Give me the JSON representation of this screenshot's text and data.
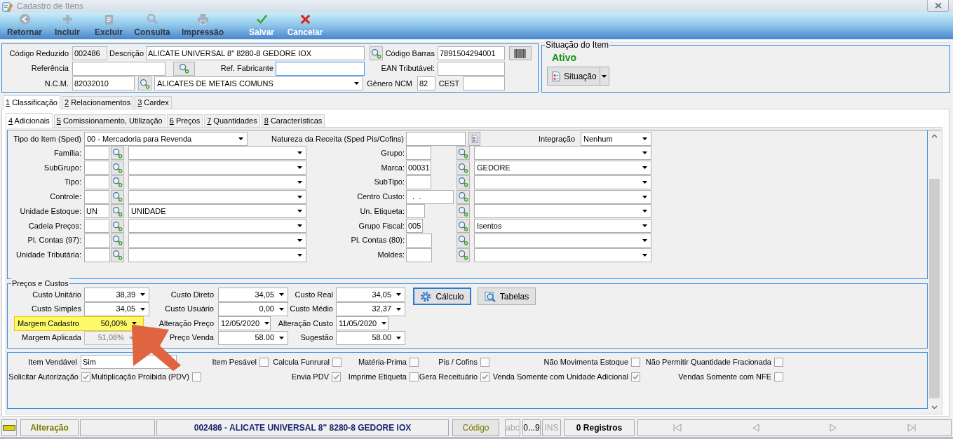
{
  "window": {
    "title": "Cadastro de Itens"
  },
  "toolbar": [
    {
      "label": "Retornar",
      "disabled": true
    },
    {
      "label": "Incluir",
      "disabled": true
    },
    {
      "label": "Excluir",
      "disabled": true
    },
    {
      "label": "Consulta",
      "disabled": true
    },
    {
      "label": "Impressão",
      "disabled": true
    },
    {
      "label": "Salvar",
      "disabled": false
    },
    {
      "label": "Cancelar",
      "disabled": false
    }
  ],
  "item_header": {
    "codigo_reduzido": {
      "label": "Código Reduzido",
      "value": "002486",
      "readonly": true
    },
    "descricao": {
      "label": "Descrição",
      "value": "ALICATE UNIVERSAL 8\" 8280-8 GEDORE IOX"
    },
    "codigo_barras": {
      "label": "Código Barras",
      "value": "7891504294001"
    },
    "referencia": {
      "label": "Referência"
    },
    "ref_fabricante": {
      "label": "Ref. Fabricante",
      "focused": true
    },
    "ean_tributavel": {
      "label": "EAN Tributável:"
    },
    "ncm": {
      "label": "N.C.M.",
      "value": "82032010",
      "description": "ALICATES DE METAIS COMUNS"
    },
    "genero_ncm": {
      "label": "Gênero NCM",
      "value": "82"
    },
    "cest": {
      "label": "CEST"
    }
  },
  "situacao": {
    "title": "Situação do Item",
    "status": "Ativo",
    "button": "Situação"
  },
  "tabs": [
    {
      "label": "1 Classificação",
      "selected": true
    },
    {
      "label": "2 Relacionamentos",
      "selected": false
    },
    {
      "label": "3 Cardex",
      "selected": false
    }
  ],
  "subtabs": [
    {
      "label": "4 Adicionais",
      "selected": true
    },
    {
      "label": "5 Comissionamento, Utilização",
      "selected": false
    },
    {
      "label": "6 Preços",
      "selected": false
    },
    {
      "label": "7 Quantidades",
      "selected": false
    },
    {
      "label": "8 Características",
      "selected": false
    }
  ],
  "classificacao": {
    "tipo_item": {
      "label": "Tipo do Item (Sped)",
      "value": "00 - Mercadoria para Revenda"
    },
    "natureza_receita": {
      "label": "Natureza da Receita (Sped Pis/Cofins)"
    },
    "integracao": {
      "label": "Integração",
      "value": "Nenhum"
    },
    "left_fields": [
      {
        "label": "Família:"
      },
      {
        "label": "SubGrupo:"
      },
      {
        "label": "Tipo:"
      },
      {
        "label": "Controle:"
      },
      {
        "label": "Unidade Estoque:",
        "code": "UN",
        "description": "UNIDADE"
      },
      {
        "label": "Cadeia Preços:"
      },
      {
        "label": "Pl. Contas (97):"
      },
      {
        "label": "Unidade Tributária:"
      }
    ],
    "right_fields": [
      {
        "label": "Grupo:"
      },
      {
        "label": "Marca:",
        "code": "00031",
        "description": "GEDORE"
      },
      {
        "label": "SubTipo:"
      },
      {
        "label": "Centro Custo:",
        "code": "  .  ."
      },
      {
        "label": "Un. Etiqueta:"
      },
      {
        "label": "Grupo Fiscal:",
        "code": "005",
        "description": "Isentos"
      },
      {
        "label": "Pl. Contas (80):"
      },
      {
        "label": "Moldes:"
      }
    ]
  },
  "precos": {
    "title": "Preços e Custos",
    "rows": [
      [
        {
          "label": "Custo Unitário",
          "value": "38,39",
          "kind": "number",
          "highlighted": false,
          "disabled": false
        },
        {
          "label": "Custo Direto",
          "value": "34,05",
          "kind": "number",
          "highlighted": false,
          "disabled": false
        },
        {
          "label": "Custo Real",
          "value": "34,05",
          "kind": "number",
          "highlighted": false,
          "disabled": false
        }
      ],
      [
        {
          "label": "Custo Simples",
          "value": "34,05",
          "kind": "number",
          "highlighted": false,
          "disabled": false
        },
        {
          "label": "Custo Usuário",
          "value": "0,00",
          "kind": "number",
          "highlighted": false,
          "disabled": false
        },
        {
          "label": "Custo Médio",
          "value": "32,37",
          "kind": "number",
          "highlighted": false,
          "disabled": false
        }
      ],
      [
        {
          "label": "Margem Cadastro",
          "value": "50,00%",
          "kind": "number",
          "highlighted": true,
          "disabled": false
        },
        {
          "label": "Alteração Preço",
          "value": "12/05/2020",
          "kind": "date",
          "highlighted": false,
          "disabled": false
        },
        {
          "label": "Alteração Custo",
          "value": "11/05/2020",
          "kind": "date",
          "highlighted": false,
          "disabled": false
        }
      ],
      [
        {
          "label": "Margem Aplicada",
          "value": "51,08%",
          "kind": "number",
          "highlighted": false,
          "disabled": true
        },
        {
          "label": "Preço Venda",
          "value": "58.00",
          "kind": "number",
          "highlighted": false,
          "disabled": false
        },
        {
          "label": "Sugestão",
          "value": "58.00",
          "kind": "number",
          "highlighted": false,
          "disabled": false
        }
      ]
    ],
    "buttons": [
      {
        "label": "Cálculo",
        "focused": true
      },
      {
        "label": "Tabelas",
        "focused": false
      }
    ]
  },
  "opcoes": {
    "item_vendavel": {
      "label": "Item Vendável",
      "value": "Sim"
    },
    "checkbox_rows": [
      [
        {
          "label": "Item Pesável",
          "checked": false
        },
        {
          "label": "Calcula Funrural",
          "checked": false
        },
        {
          "label": "Matéria-Prima",
          "checked": false
        },
        {
          "label": "Pis / Cofins",
          "checked": false
        },
        {
          "label": "Não Movimenta Estoque",
          "checked": false
        },
        {
          "label": "Não Permitir Quantidade Fracionada",
          "checked": false
        }
      ],
      [
        {
          "label": "Solicitar Autorização",
          "checked": true
        },
        {
          "label": "Multiplicação Proibida (PDV)",
          "checked": false
        },
        {
          "label": "Envia PDV",
          "checked": true
        },
        {
          "label": "Imprime Etiqueta",
          "checked": false
        },
        {
          "label": "Gera Receituário",
          "checked": true
        },
        {
          "label": "Venda Somente com Unidade Adicional",
          "checked": true
        },
        {
          "label": "Vendas Somente com NFE",
          "checked": false
        }
      ]
    ]
  },
  "status_bar": {
    "mode": "Alteração",
    "record": "002486 - ALICATE UNIVERSAL 8\" 8280-8 GEDORE IOX",
    "sort_button": "Código",
    "indicators": [
      {
        "label": "abc",
        "on": false
      },
      {
        "label": "0...9",
        "on": true
      },
      {
        "label": "INS",
        "on": false
      }
    ],
    "count": "0 Registros"
  }
}
